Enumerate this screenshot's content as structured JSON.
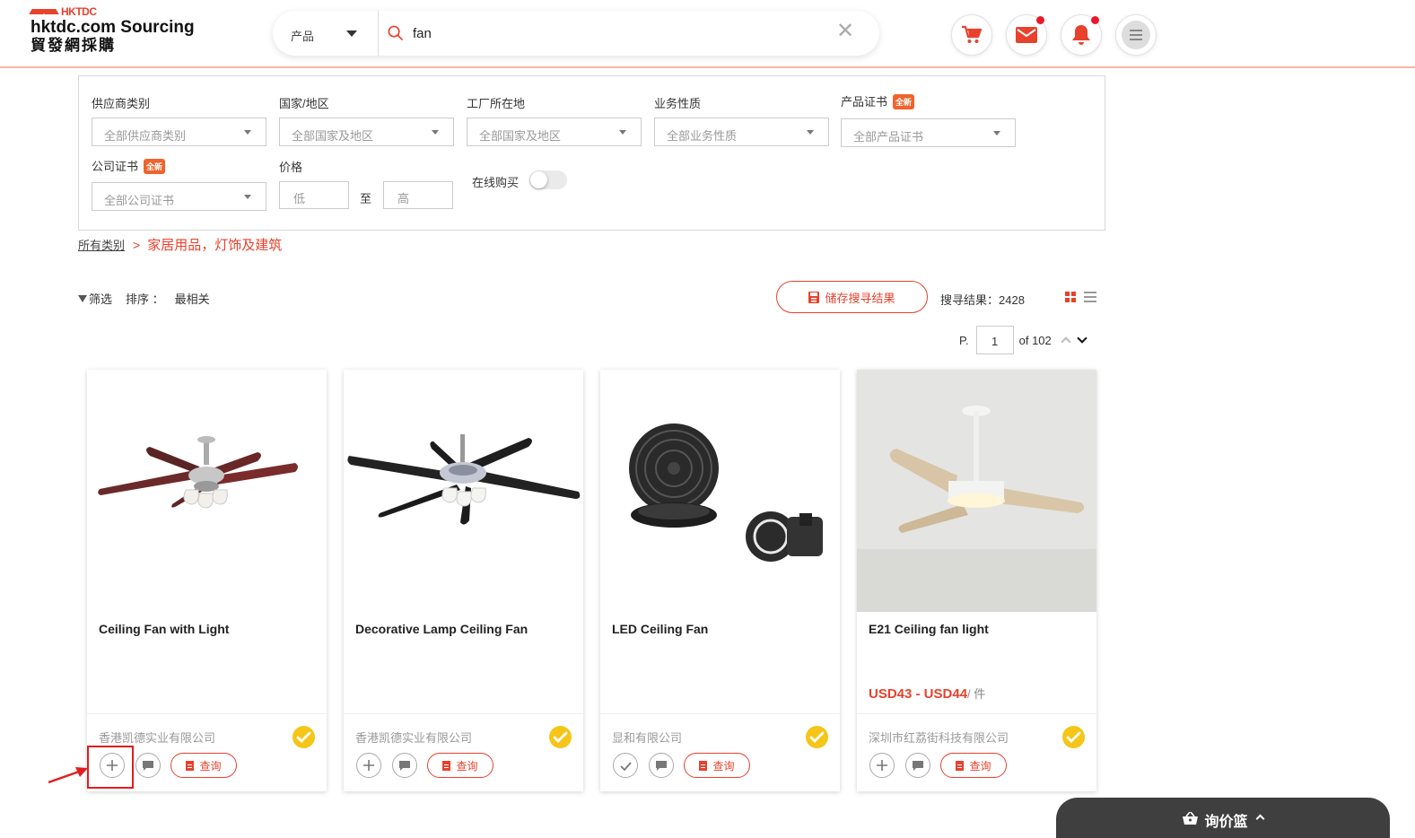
{
  "header": {
    "logo_hk": "HKTDC",
    "logo_name": "hktdc.com Sourcing",
    "logo_cn": "貿發網採購",
    "search_type": "产品",
    "search_value": "fan",
    "icons": [
      "cart-icon",
      "mail-icon",
      "bell-icon",
      "menu-icon"
    ],
    "accent_color": "#e8412c"
  },
  "filters": {
    "supplier_type": {
      "label": "供应商类别",
      "value": "全部供应商类别"
    },
    "region": {
      "label": "国家/地区",
      "value": "全部国家及地区"
    },
    "factory": {
      "label": "工厂所在地",
      "value": "全部国家及地区"
    },
    "business": {
      "label": "业务性质",
      "value": "全部业务性质"
    },
    "product_cert": {
      "label": "产品证书",
      "badge": "全新",
      "value": "全部产品证书"
    },
    "company_cert": {
      "label": "公司证书",
      "badge": "全新",
      "value": "全部公司证书"
    },
    "price": {
      "label": "价格",
      "low": "低",
      "to": "至",
      "high": "高"
    },
    "online_buy": {
      "label": "在线购买",
      "enabled": false
    }
  },
  "breadcrumb": {
    "root": "所有类别",
    "current": "家居用品，灯饰及建筑"
  },
  "toolbar": {
    "filter_label": "筛选",
    "sort_label": "排序 ：",
    "sort_value": "最相关",
    "save_search": "储存搜寻结果",
    "result_count": "搜寻结果：2428"
  },
  "pager": {
    "prefix": "P.",
    "current": "1",
    "total": "of 102"
  },
  "products": [
    {
      "title": "Ceiling Fan with Light",
      "price": "",
      "unit": "",
      "company": "香港凯德实业有限公司",
      "inquire": "查询",
      "added": false
    },
    {
      "title": "Decorative Lamp Ceiling Fan",
      "price": "",
      "unit": "",
      "company": "香港凯德实业有限公司",
      "inquire": "查询",
      "added": false
    },
    {
      "title": "LED Ceiling Fan",
      "price": "",
      "unit": "",
      "company": "显和有限公司",
      "inquire": "查询",
      "added": true
    },
    {
      "title": "E21 Ceiling fan light",
      "price": "USD43 - USD44",
      "unit": "/ 件",
      "company": "深圳市红荔街科技有限公司",
      "inquire": "查询",
      "added": false
    }
  ],
  "basket": {
    "label": "询价篮"
  }
}
